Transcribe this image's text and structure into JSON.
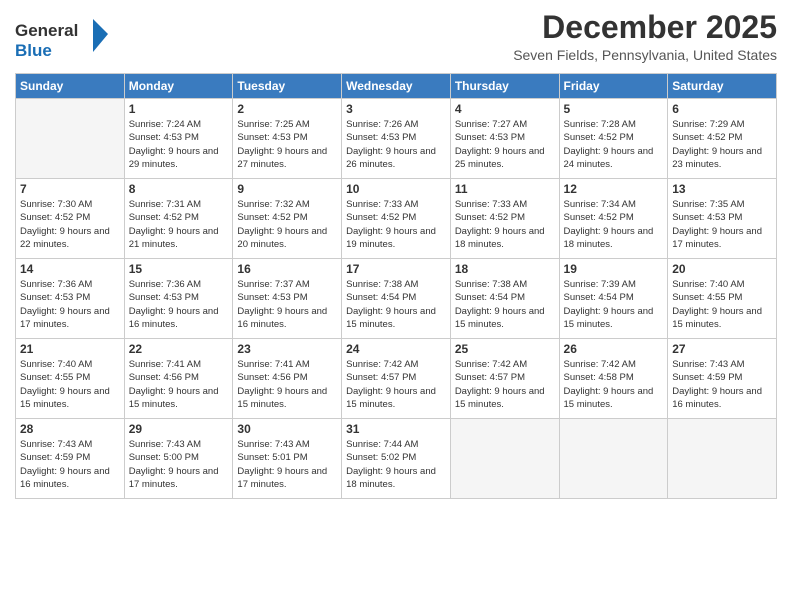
{
  "logo": {
    "line1": "General",
    "line2": "Blue"
  },
  "title": "December 2025",
  "location": "Seven Fields, Pennsylvania, United States",
  "days_header": [
    "Sunday",
    "Monday",
    "Tuesday",
    "Wednesday",
    "Thursday",
    "Friday",
    "Saturday"
  ],
  "weeks": [
    [
      {
        "num": "",
        "sunrise": "",
        "sunset": "",
        "daylight": ""
      },
      {
        "num": "1",
        "sunrise": "Sunrise: 7:24 AM",
        "sunset": "Sunset: 4:53 PM",
        "daylight": "Daylight: 9 hours and 29 minutes."
      },
      {
        "num": "2",
        "sunrise": "Sunrise: 7:25 AM",
        "sunset": "Sunset: 4:53 PM",
        "daylight": "Daylight: 9 hours and 27 minutes."
      },
      {
        "num": "3",
        "sunrise": "Sunrise: 7:26 AM",
        "sunset": "Sunset: 4:53 PM",
        "daylight": "Daylight: 9 hours and 26 minutes."
      },
      {
        "num": "4",
        "sunrise": "Sunrise: 7:27 AM",
        "sunset": "Sunset: 4:53 PM",
        "daylight": "Daylight: 9 hours and 25 minutes."
      },
      {
        "num": "5",
        "sunrise": "Sunrise: 7:28 AM",
        "sunset": "Sunset: 4:52 PM",
        "daylight": "Daylight: 9 hours and 24 minutes."
      },
      {
        "num": "6",
        "sunrise": "Sunrise: 7:29 AM",
        "sunset": "Sunset: 4:52 PM",
        "daylight": "Daylight: 9 hours and 23 minutes."
      }
    ],
    [
      {
        "num": "7",
        "sunrise": "Sunrise: 7:30 AM",
        "sunset": "Sunset: 4:52 PM",
        "daylight": "Daylight: 9 hours and 22 minutes."
      },
      {
        "num": "8",
        "sunrise": "Sunrise: 7:31 AM",
        "sunset": "Sunset: 4:52 PM",
        "daylight": "Daylight: 9 hours and 21 minutes."
      },
      {
        "num": "9",
        "sunrise": "Sunrise: 7:32 AM",
        "sunset": "Sunset: 4:52 PM",
        "daylight": "Daylight: 9 hours and 20 minutes."
      },
      {
        "num": "10",
        "sunrise": "Sunrise: 7:33 AM",
        "sunset": "Sunset: 4:52 PM",
        "daylight": "Daylight: 9 hours and 19 minutes."
      },
      {
        "num": "11",
        "sunrise": "Sunrise: 7:33 AM",
        "sunset": "Sunset: 4:52 PM",
        "daylight": "Daylight: 9 hours and 18 minutes."
      },
      {
        "num": "12",
        "sunrise": "Sunrise: 7:34 AM",
        "sunset": "Sunset: 4:52 PM",
        "daylight": "Daylight: 9 hours and 18 minutes."
      },
      {
        "num": "13",
        "sunrise": "Sunrise: 7:35 AM",
        "sunset": "Sunset: 4:53 PM",
        "daylight": "Daylight: 9 hours and 17 minutes."
      }
    ],
    [
      {
        "num": "14",
        "sunrise": "Sunrise: 7:36 AM",
        "sunset": "Sunset: 4:53 PM",
        "daylight": "Daylight: 9 hours and 17 minutes."
      },
      {
        "num": "15",
        "sunrise": "Sunrise: 7:36 AM",
        "sunset": "Sunset: 4:53 PM",
        "daylight": "Daylight: 9 hours and 16 minutes."
      },
      {
        "num": "16",
        "sunrise": "Sunrise: 7:37 AM",
        "sunset": "Sunset: 4:53 PM",
        "daylight": "Daylight: 9 hours and 16 minutes."
      },
      {
        "num": "17",
        "sunrise": "Sunrise: 7:38 AM",
        "sunset": "Sunset: 4:54 PM",
        "daylight": "Daylight: 9 hours and 15 minutes."
      },
      {
        "num": "18",
        "sunrise": "Sunrise: 7:38 AM",
        "sunset": "Sunset: 4:54 PM",
        "daylight": "Daylight: 9 hours and 15 minutes."
      },
      {
        "num": "19",
        "sunrise": "Sunrise: 7:39 AM",
        "sunset": "Sunset: 4:54 PM",
        "daylight": "Daylight: 9 hours and 15 minutes."
      },
      {
        "num": "20",
        "sunrise": "Sunrise: 7:40 AM",
        "sunset": "Sunset: 4:55 PM",
        "daylight": "Daylight: 9 hours and 15 minutes."
      }
    ],
    [
      {
        "num": "21",
        "sunrise": "Sunrise: 7:40 AM",
        "sunset": "Sunset: 4:55 PM",
        "daylight": "Daylight: 9 hours and 15 minutes."
      },
      {
        "num": "22",
        "sunrise": "Sunrise: 7:41 AM",
        "sunset": "Sunset: 4:56 PM",
        "daylight": "Daylight: 9 hours and 15 minutes."
      },
      {
        "num": "23",
        "sunrise": "Sunrise: 7:41 AM",
        "sunset": "Sunset: 4:56 PM",
        "daylight": "Daylight: 9 hours and 15 minutes."
      },
      {
        "num": "24",
        "sunrise": "Sunrise: 7:42 AM",
        "sunset": "Sunset: 4:57 PM",
        "daylight": "Daylight: 9 hours and 15 minutes."
      },
      {
        "num": "25",
        "sunrise": "Sunrise: 7:42 AM",
        "sunset": "Sunset: 4:57 PM",
        "daylight": "Daylight: 9 hours and 15 minutes."
      },
      {
        "num": "26",
        "sunrise": "Sunrise: 7:42 AM",
        "sunset": "Sunset: 4:58 PM",
        "daylight": "Daylight: 9 hours and 15 minutes."
      },
      {
        "num": "27",
        "sunrise": "Sunrise: 7:43 AM",
        "sunset": "Sunset: 4:59 PM",
        "daylight": "Daylight: 9 hours and 16 minutes."
      }
    ],
    [
      {
        "num": "28",
        "sunrise": "Sunrise: 7:43 AM",
        "sunset": "Sunset: 4:59 PM",
        "daylight": "Daylight: 9 hours and 16 minutes."
      },
      {
        "num": "29",
        "sunrise": "Sunrise: 7:43 AM",
        "sunset": "Sunset: 5:00 PM",
        "daylight": "Daylight: 9 hours and 17 minutes."
      },
      {
        "num": "30",
        "sunrise": "Sunrise: 7:43 AM",
        "sunset": "Sunset: 5:01 PM",
        "daylight": "Daylight: 9 hours and 17 minutes."
      },
      {
        "num": "31",
        "sunrise": "Sunrise: 7:44 AM",
        "sunset": "Sunset: 5:02 PM",
        "daylight": "Daylight: 9 hours and 18 minutes."
      },
      {
        "num": "",
        "sunrise": "",
        "sunset": "",
        "daylight": ""
      },
      {
        "num": "",
        "sunrise": "",
        "sunset": "",
        "daylight": ""
      },
      {
        "num": "",
        "sunrise": "",
        "sunset": "",
        "daylight": ""
      }
    ]
  ]
}
